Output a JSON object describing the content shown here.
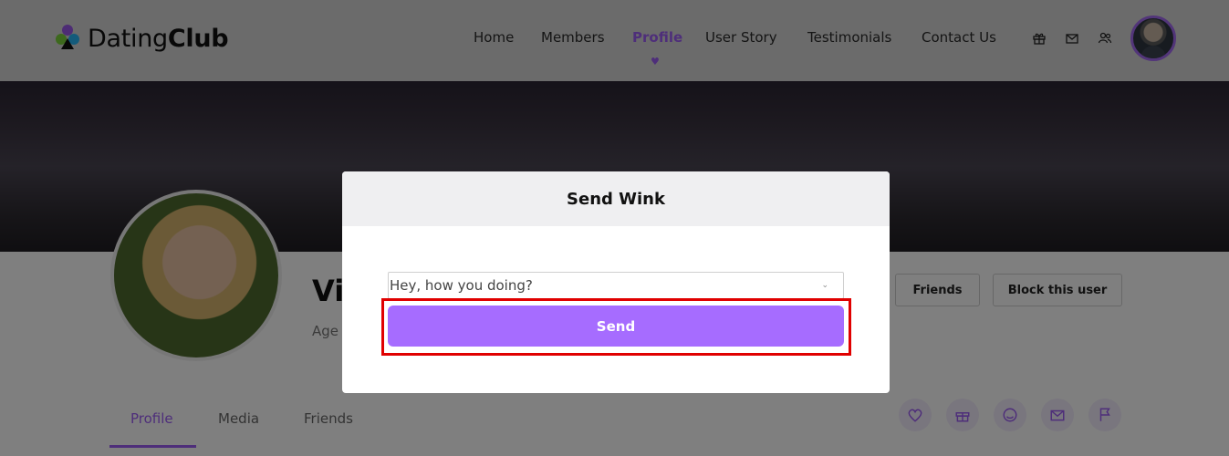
{
  "brand": {
    "light": "Dating",
    "bold": "Club"
  },
  "nav": {
    "items": [
      {
        "label": "Home",
        "active": false
      },
      {
        "label": "Members",
        "active": false
      },
      {
        "label": "Profile",
        "active": true
      },
      {
        "label": "User Story",
        "active": false
      },
      {
        "label": "Testimonials",
        "active": false
      },
      {
        "label": "Contact Us",
        "active": false
      }
    ],
    "active_marker": "heart-icon",
    "icons": [
      "gift-icon",
      "mail-icon",
      "users-icon"
    ]
  },
  "profile": {
    "name_partial": "Vic",
    "age_partial": "Age",
    "buttons": {
      "friends": "Friends",
      "block": "Block this user"
    },
    "tabs": [
      "Profile",
      "Media",
      "Friends"
    ],
    "active_tab": "Profile",
    "action_icons": [
      "heart-icon",
      "gift-icon",
      "smile-icon",
      "mail-icon",
      "flag-icon"
    ]
  },
  "modal": {
    "title": "Send Wink",
    "select_value": "Hey, how you doing?",
    "send_label": "Send"
  },
  "colors": {
    "accent": "#a66cff",
    "highlight": "#e00000",
    "header_bg": "#d6d6d6"
  }
}
